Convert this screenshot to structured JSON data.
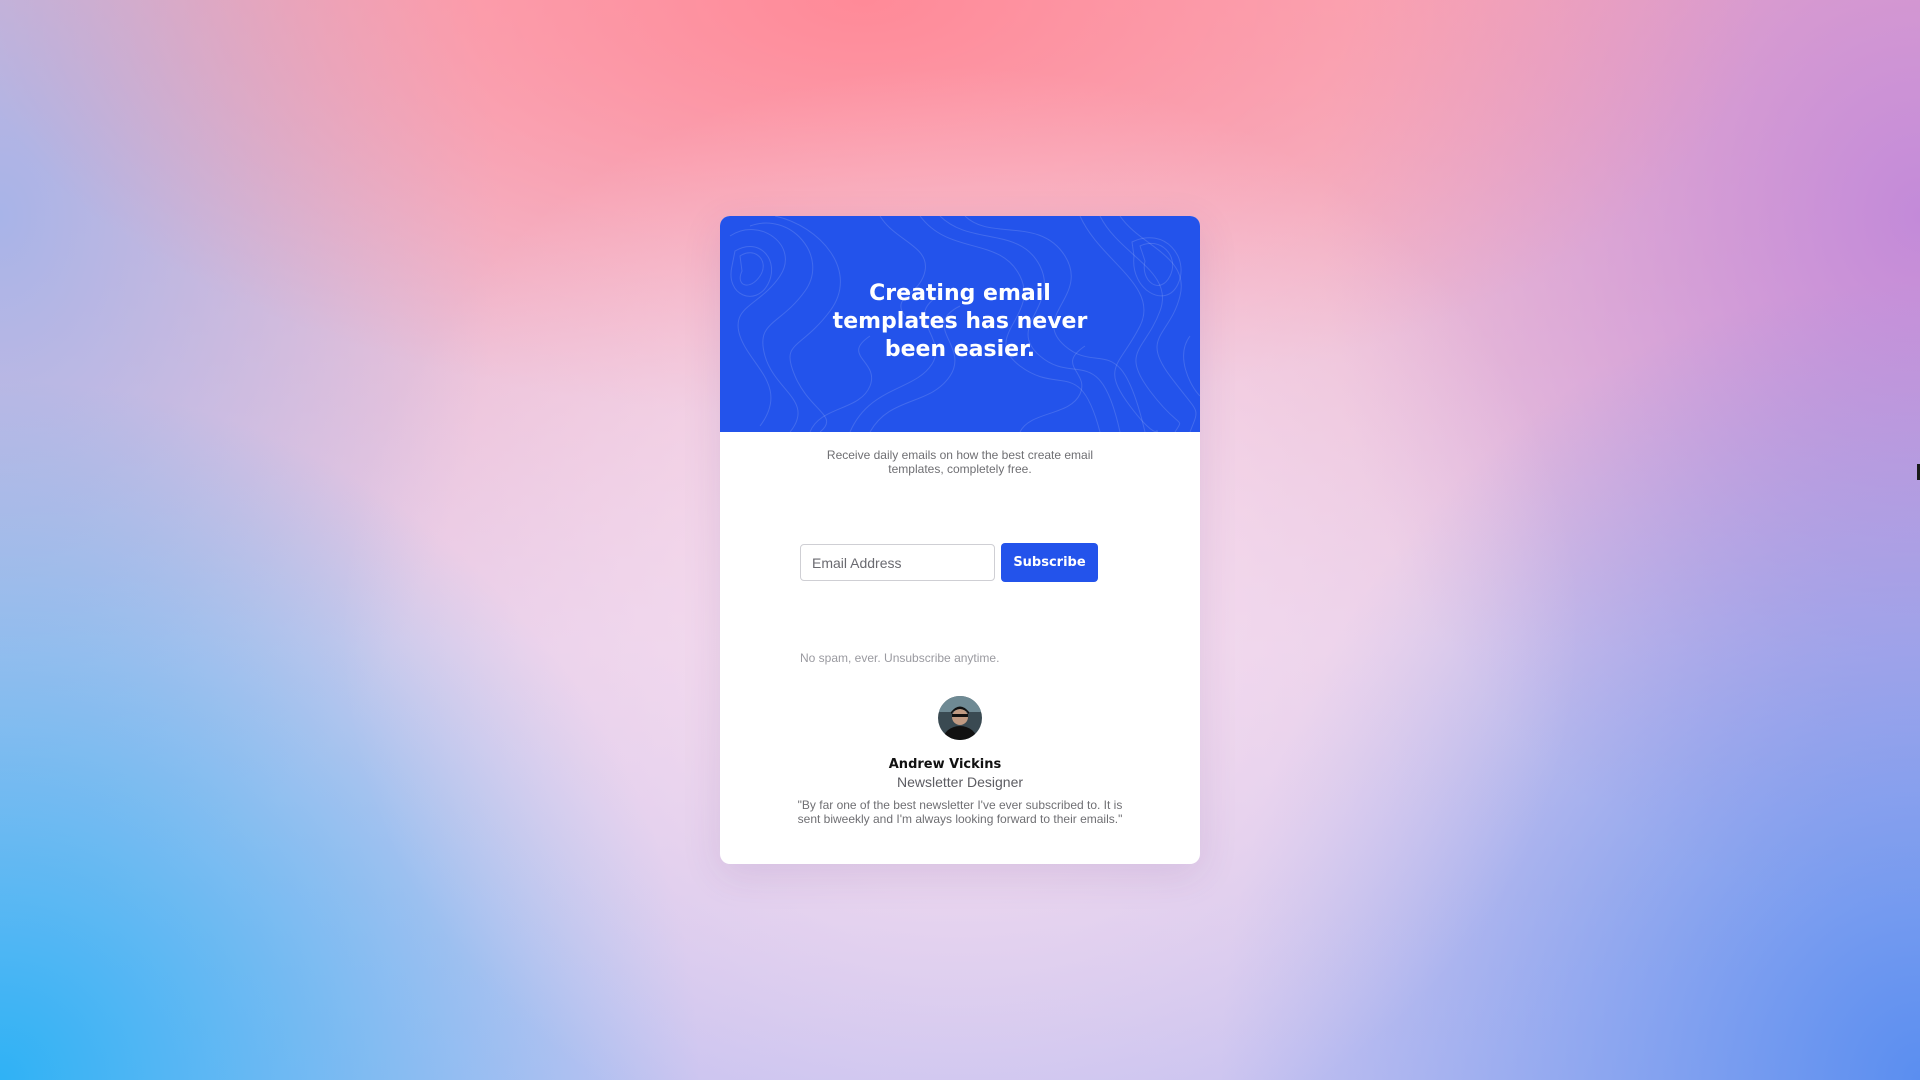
{
  "hero": {
    "title": "Creating email templates has never been easier."
  },
  "description": "Receive daily emails on how the best create email templates, completely free.",
  "form": {
    "email_placeholder": "Email Address",
    "email_value": "",
    "subscribe_label": "Subscribe"
  },
  "disclaimer": "No spam, ever. Unsubscribe anytime.",
  "testimonial": {
    "name": "Andrew Vickins",
    "role": "Newsletter Designer",
    "quote": "\"By far one of the best newsletter I've ever subscribed to. It is sent biweekly and I'm always looking forward to their emails.\""
  },
  "colors": {
    "accent": "#2353eb",
    "card_background": "#ffffff"
  },
  "icons": {
    "avatar": "person-avatar"
  }
}
